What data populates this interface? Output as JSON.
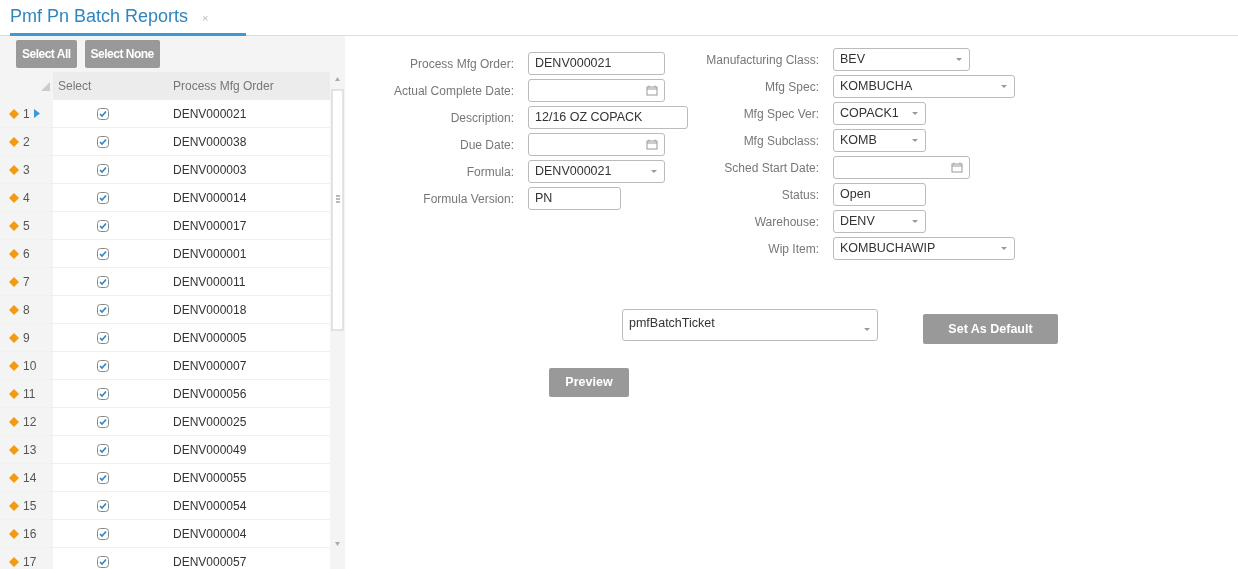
{
  "tab": {
    "title": "Pmf Pn Batch Reports",
    "close": "×",
    "selected": true
  },
  "grid_buttons": [
    "Select All",
    "Select None"
  ],
  "grid": {
    "columns": [
      "Select",
      "Process Mfg Order"
    ],
    "rows": [
      {
        "number": "1",
        "current": true,
        "checked": true,
        "order": "DENV000021"
      },
      {
        "number": "2",
        "current": false,
        "checked": true,
        "order": "DENV000038"
      },
      {
        "number": "3",
        "current": false,
        "checked": true,
        "order": "DENV000003"
      },
      {
        "number": "4",
        "current": false,
        "checked": true,
        "order": "DENV000014"
      },
      {
        "number": "5",
        "current": false,
        "checked": true,
        "order": "DENV000017"
      },
      {
        "number": "6",
        "current": false,
        "checked": true,
        "order": "DENV000001"
      },
      {
        "number": "7",
        "current": false,
        "checked": true,
        "order": "DENV000011"
      },
      {
        "number": "8",
        "current": false,
        "checked": true,
        "order": "DENV000018"
      },
      {
        "number": "9",
        "current": false,
        "checked": true,
        "order": "DENV000005"
      },
      {
        "number": "10",
        "current": false,
        "checked": true,
        "order": "DENV000007"
      },
      {
        "number": "11",
        "current": false,
        "checked": true,
        "order": "DENV000056"
      },
      {
        "number": "12",
        "current": false,
        "checked": true,
        "order": "DENV000025"
      },
      {
        "number": "13",
        "current": false,
        "checked": true,
        "order": "DENV000049"
      },
      {
        "number": "14",
        "current": false,
        "checked": true,
        "order": "DENV000055"
      },
      {
        "number": "15",
        "current": false,
        "checked": true,
        "order": "DENV000054"
      },
      {
        "number": "16",
        "current": false,
        "checked": true,
        "order": "DENV000004"
      },
      {
        "number": "17",
        "current": false,
        "checked": true,
        "order": "DENV000057"
      }
    ]
  },
  "form_left": [
    {
      "label": "Process Mfg Order:",
      "kind": "text",
      "value": "DENV000021"
    },
    {
      "label": "Actual Complete Date:",
      "kind": "date"
    },
    {
      "label": "Description:",
      "kind": "text",
      "value": "12/16 OZ COPACK"
    },
    {
      "label": "Due Date:",
      "kind": "date"
    },
    {
      "label": "Formula:",
      "kind": "select",
      "value": "DENV000021"
    },
    {
      "label": "Formula Version:",
      "kind": "text",
      "value": "PN"
    }
  ],
  "form_right": [
    {
      "label": "Manufacturing Class:",
      "kind": "select",
      "value": "BEV"
    },
    {
      "label": "Mfg Spec:",
      "kind": "select",
      "value": "KOMBUCHA"
    },
    {
      "label": "Mfg Spec Ver:",
      "kind": "select",
      "value": "COPACK1"
    },
    {
      "label": "Mfg Subclass:",
      "kind": "select",
      "value": "KOMB"
    },
    {
      "label": "Sched Start Date:",
      "kind": "date"
    },
    {
      "label": "Status:",
      "kind": "text",
      "value": "Open"
    },
    {
      "label": "Warehouse:",
      "kind": "select",
      "value": "DENV"
    },
    {
      "label": "Wip Item:",
      "kind": "select",
      "value": "KOMBUCHAWIP"
    }
  ],
  "report": {
    "value": "pmfBatchTicket"
  },
  "set_default_button": "Set As Default",
  "preview_button": "Preview"
}
